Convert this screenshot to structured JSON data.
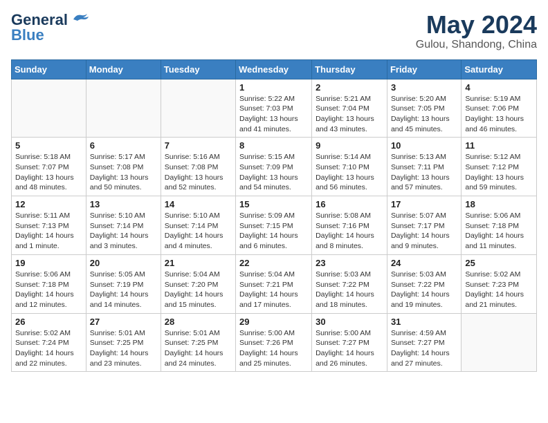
{
  "header": {
    "logo_general": "General",
    "logo_blue": "Blue",
    "month_year": "May 2024",
    "location": "Gulou, Shandong, China"
  },
  "days_of_week": [
    "Sunday",
    "Monday",
    "Tuesday",
    "Wednesday",
    "Thursday",
    "Friday",
    "Saturday"
  ],
  "weeks": [
    [
      {
        "day": "",
        "sunrise": "",
        "sunset": "",
        "daylight": ""
      },
      {
        "day": "",
        "sunrise": "",
        "sunset": "",
        "daylight": ""
      },
      {
        "day": "",
        "sunrise": "",
        "sunset": "",
        "daylight": ""
      },
      {
        "day": "1",
        "sunrise": "Sunrise: 5:22 AM",
        "sunset": "Sunset: 7:03 PM",
        "daylight": "Daylight: 13 hours and 41 minutes."
      },
      {
        "day": "2",
        "sunrise": "Sunrise: 5:21 AM",
        "sunset": "Sunset: 7:04 PM",
        "daylight": "Daylight: 13 hours and 43 minutes."
      },
      {
        "day": "3",
        "sunrise": "Sunrise: 5:20 AM",
        "sunset": "Sunset: 7:05 PM",
        "daylight": "Daylight: 13 hours and 45 minutes."
      },
      {
        "day": "4",
        "sunrise": "Sunrise: 5:19 AM",
        "sunset": "Sunset: 7:06 PM",
        "daylight": "Daylight: 13 hours and 46 minutes."
      }
    ],
    [
      {
        "day": "5",
        "sunrise": "Sunrise: 5:18 AM",
        "sunset": "Sunset: 7:07 PM",
        "daylight": "Daylight: 13 hours and 48 minutes."
      },
      {
        "day": "6",
        "sunrise": "Sunrise: 5:17 AM",
        "sunset": "Sunset: 7:08 PM",
        "daylight": "Daylight: 13 hours and 50 minutes."
      },
      {
        "day": "7",
        "sunrise": "Sunrise: 5:16 AM",
        "sunset": "Sunset: 7:08 PM",
        "daylight": "Daylight: 13 hours and 52 minutes."
      },
      {
        "day": "8",
        "sunrise": "Sunrise: 5:15 AM",
        "sunset": "Sunset: 7:09 PM",
        "daylight": "Daylight: 13 hours and 54 minutes."
      },
      {
        "day": "9",
        "sunrise": "Sunrise: 5:14 AM",
        "sunset": "Sunset: 7:10 PM",
        "daylight": "Daylight: 13 hours and 56 minutes."
      },
      {
        "day": "10",
        "sunrise": "Sunrise: 5:13 AM",
        "sunset": "Sunset: 7:11 PM",
        "daylight": "Daylight: 13 hours and 57 minutes."
      },
      {
        "day": "11",
        "sunrise": "Sunrise: 5:12 AM",
        "sunset": "Sunset: 7:12 PM",
        "daylight": "Daylight: 13 hours and 59 minutes."
      }
    ],
    [
      {
        "day": "12",
        "sunrise": "Sunrise: 5:11 AM",
        "sunset": "Sunset: 7:13 PM",
        "daylight": "Daylight: 14 hours and 1 minute."
      },
      {
        "day": "13",
        "sunrise": "Sunrise: 5:10 AM",
        "sunset": "Sunset: 7:14 PM",
        "daylight": "Daylight: 14 hours and 3 minutes."
      },
      {
        "day": "14",
        "sunrise": "Sunrise: 5:10 AM",
        "sunset": "Sunset: 7:14 PM",
        "daylight": "Daylight: 14 hours and 4 minutes."
      },
      {
        "day": "15",
        "sunrise": "Sunrise: 5:09 AM",
        "sunset": "Sunset: 7:15 PM",
        "daylight": "Daylight: 14 hours and 6 minutes."
      },
      {
        "day": "16",
        "sunrise": "Sunrise: 5:08 AM",
        "sunset": "Sunset: 7:16 PM",
        "daylight": "Daylight: 14 hours and 8 minutes."
      },
      {
        "day": "17",
        "sunrise": "Sunrise: 5:07 AM",
        "sunset": "Sunset: 7:17 PM",
        "daylight": "Daylight: 14 hours and 9 minutes."
      },
      {
        "day": "18",
        "sunrise": "Sunrise: 5:06 AM",
        "sunset": "Sunset: 7:18 PM",
        "daylight": "Daylight: 14 hours and 11 minutes."
      }
    ],
    [
      {
        "day": "19",
        "sunrise": "Sunrise: 5:06 AM",
        "sunset": "Sunset: 7:18 PM",
        "daylight": "Daylight: 14 hours and 12 minutes."
      },
      {
        "day": "20",
        "sunrise": "Sunrise: 5:05 AM",
        "sunset": "Sunset: 7:19 PM",
        "daylight": "Daylight: 14 hours and 14 minutes."
      },
      {
        "day": "21",
        "sunrise": "Sunrise: 5:04 AM",
        "sunset": "Sunset: 7:20 PM",
        "daylight": "Daylight: 14 hours and 15 minutes."
      },
      {
        "day": "22",
        "sunrise": "Sunrise: 5:04 AM",
        "sunset": "Sunset: 7:21 PM",
        "daylight": "Daylight: 14 hours and 17 minutes."
      },
      {
        "day": "23",
        "sunrise": "Sunrise: 5:03 AM",
        "sunset": "Sunset: 7:22 PM",
        "daylight": "Daylight: 14 hours and 18 minutes."
      },
      {
        "day": "24",
        "sunrise": "Sunrise: 5:03 AM",
        "sunset": "Sunset: 7:22 PM",
        "daylight": "Daylight: 14 hours and 19 minutes."
      },
      {
        "day": "25",
        "sunrise": "Sunrise: 5:02 AM",
        "sunset": "Sunset: 7:23 PM",
        "daylight": "Daylight: 14 hours and 21 minutes."
      }
    ],
    [
      {
        "day": "26",
        "sunrise": "Sunrise: 5:02 AM",
        "sunset": "Sunset: 7:24 PM",
        "daylight": "Daylight: 14 hours and 22 minutes."
      },
      {
        "day": "27",
        "sunrise": "Sunrise: 5:01 AM",
        "sunset": "Sunset: 7:25 PM",
        "daylight": "Daylight: 14 hours and 23 minutes."
      },
      {
        "day": "28",
        "sunrise": "Sunrise: 5:01 AM",
        "sunset": "Sunset: 7:25 PM",
        "daylight": "Daylight: 14 hours and 24 minutes."
      },
      {
        "day": "29",
        "sunrise": "Sunrise: 5:00 AM",
        "sunset": "Sunset: 7:26 PM",
        "daylight": "Daylight: 14 hours and 25 minutes."
      },
      {
        "day": "30",
        "sunrise": "Sunrise: 5:00 AM",
        "sunset": "Sunset: 7:27 PM",
        "daylight": "Daylight: 14 hours and 26 minutes."
      },
      {
        "day": "31",
        "sunrise": "Sunrise: 4:59 AM",
        "sunset": "Sunset: 7:27 PM",
        "daylight": "Daylight: 14 hours and 27 minutes."
      },
      {
        "day": "",
        "sunrise": "",
        "sunset": "",
        "daylight": ""
      }
    ]
  ]
}
